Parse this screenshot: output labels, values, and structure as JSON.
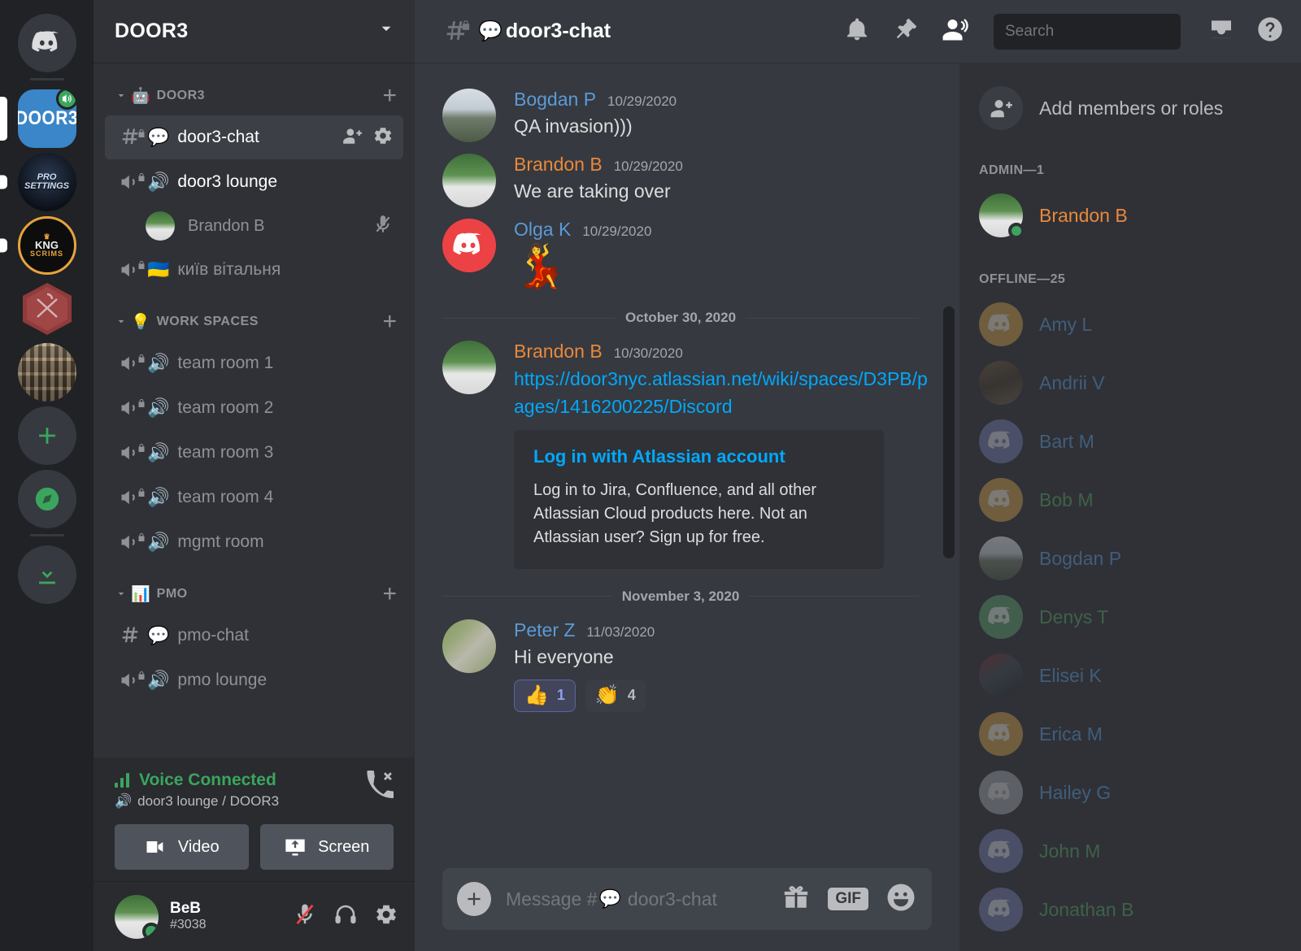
{
  "server_rail": {
    "home_label": "Discord Home",
    "servers": [
      {
        "name": "DOOR3",
        "type": "door3",
        "selected": true,
        "voice_active": true
      },
      {
        "name": "PRO SETTINGS",
        "type": "pro",
        "line1": "PRO",
        "line2": "SETTINGS",
        "unread": true
      },
      {
        "name": "KNG SCRIMS",
        "type": "kng",
        "line1": "KNG",
        "line2": "SCRIMS",
        "unread": true
      },
      {
        "name": "Hex Clan",
        "type": "hex",
        "unread": false
      },
      {
        "name": "Bookshelf Server",
        "type": "books",
        "unread": false
      }
    ],
    "add_server_label": "Add a Server",
    "explore_label": "Explore Public Servers",
    "download_label": "Download Apps"
  },
  "sidebar": {
    "guild_name": "DOOR3",
    "guild_dropdown_icon": "chevron-down-icon",
    "categories": [
      {
        "name": "DOOR3",
        "emoji": "🤖",
        "add_icon": "plus-icon",
        "channels": [
          {
            "name": "door3-chat",
            "emoji": "💬",
            "type": "text",
            "locked": true,
            "active": true,
            "actions": [
              "invite-icon",
              "gear-icon"
            ]
          },
          {
            "name": "door3 lounge",
            "emoji": "🔊",
            "type": "voice",
            "locked": true,
            "active": false,
            "voice_members": [
              {
                "name": "Brandon B",
                "muted": true
              }
            ]
          },
          {
            "name": "київ вітальня",
            "emoji": "🇺🇦",
            "type": "voice",
            "locked": true,
            "active": false
          }
        ]
      },
      {
        "name": "WORK SPACES",
        "emoji": "💡",
        "add_icon": "plus-icon",
        "channels": [
          {
            "name": "team room 1",
            "emoji": "🔊",
            "type": "voice",
            "locked": true
          },
          {
            "name": "team room 2",
            "emoji": "🔊",
            "type": "voice",
            "locked": true
          },
          {
            "name": "team room 3",
            "emoji": "🔊",
            "type": "voice",
            "locked": true
          },
          {
            "name": "team room 4",
            "emoji": "🔊",
            "type": "voice",
            "locked": true
          },
          {
            "name": "mgmt room",
            "emoji": "🔊",
            "type": "voice",
            "locked": true
          }
        ]
      },
      {
        "name": "PMO",
        "emoji": "📊",
        "add_icon": "plus-icon",
        "channels": [
          {
            "name": "pmo-chat",
            "emoji": "💬",
            "type": "text",
            "locked": false
          },
          {
            "name": "pmo lounge",
            "emoji": "🔊",
            "type": "voice",
            "locked": true
          }
        ]
      }
    ],
    "voice_panel": {
      "status": "Voice Connected",
      "channel_path": "door3 lounge / DOOR3",
      "channel_emoji": "🔊",
      "disconnect_icon": "phone-hangup-icon",
      "video_label": "Video",
      "screen_label": "Screen"
    },
    "user_panel": {
      "username": "BeB",
      "discriminator": "#3038",
      "status": "online",
      "mute_icon": "mic-muted-icon",
      "deafen_icon": "headphones-icon",
      "settings_icon": "gear-icon"
    }
  },
  "topbar": {
    "channel_name": "door3-chat",
    "channel_emoji": "💬",
    "hash_icon": "hash-lock-icon",
    "icons": [
      "bell-icon",
      "pin-icon",
      "members-icon",
      "inbox-icon",
      "help-icon"
    ],
    "search_placeholder": "Search",
    "search_value": ""
  },
  "chat": {
    "messages": [
      {
        "author": "Bogdan P",
        "color": "blue",
        "avatar": "av-bogdan",
        "timestamp": "10/29/2020",
        "text": "QA invasion)))",
        "kind": "text"
      },
      {
        "author": "Brandon B",
        "color": "orange",
        "avatar": "av-brandon",
        "timestamp": "10/29/2020",
        "text": "We are taking over",
        "kind": "text"
      },
      {
        "author": "Olga K",
        "color": "blue",
        "avatar": "av-olga",
        "timestamp": "10/29/2020",
        "text": "💃",
        "kind": "emoji"
      }
    ],
    "divider_1": "October 30, 2020",
    "message_link": {
      "author": "Brandon B",
      "color": "orange",
      "avatar": "av-brandon",
      "timestamp": "10/30/2020",
      "url": "https://door3nyc.atlassian.net/wiki/spaces/D3PB/pages/1416200225/Discord",
      "embed": {
        "title": "Log in with Atlassian account",
        "description": "Log in to Jira, Confluence, and all other Atlassian Cloud products here. Not an Atlassian user? Sign up for free."
      }
    },
    "divider_2": "November 3, 2020",
    "message_last": {
      "author": "Peter Z",
      "color": "blue",
      "avatar": "av-peter",
      "timestamp": "11/03/2020",
      "text": "Hi everyone",
      "reactions": [
        {
          "emoji": "👍",
          "count": "1",
          "mine": true
        },
        {
          "emoji": "👏",
          "count": "4",
          "mine": false
        }
      ]
    },
    "composer": {
      "placeholder_prefix": "Message #",
      "placeholder_emoji": "💬",
      "placeholder_channel": "door3-chat",
      "value": "",
      "attach_icon": "plus-circle-icon",
      "gift_icon": "gift-icon",
      "gif_label": "GIF",
      "emoji_icon": "emoji-icon"
    }
  },
  "members": {
    "add_label": "Add members or roles",
    "add_icon": "person-plus-icon",
    "groups": [
      {
        "title": "ADMIN—1",
        "people": [
          {
            "name": "Brandon B",
            "color": "#e8893c",
            "avatar": "av-brandon",
            "online": true
          }
        ]
      },
      {
        "title": "OFFLINE—25",
        "people": [
          {
            "name": "Amy L",
            "color": "#5b9ad8",
            "avatar": "av-gold",
            "online": false
          },
          {
            "name": "Andrii V",
            "color": "#5b9ad8",
            "avatar": "av-andrii",
            "online": false
          },
          {
            "name": "Bart M",
            "color": "#5b9ad8",
            "avatar": "av-blurple",
            "online": false
          },
          {
            "name": "Bob M",
            "color": "#57a463",
            "avatar": "av-gold",
            "online": false
          },
          {
            "name": "Bogdan P",
            "color": "#5b9ad8",
            "avatar": "av-bogdan",
            "online": false
          },
          {
            "name": "Denys T",
            "color": "#57a463",
            "avatar": "av-green",
            "online": false
          },
          {
            "name": "Elisei K",
            "color": "#5b9ad8",
            "avatar": "av-elisei",
            "online": false
          },
          {
            "name": "Erica M",
            "color": "#5b9ad8",
            "avatar": "av-gold",
            "online": false
          },
          {
            "name": "Hailey G",
            "color": "#5b9ad8",
            "avatar": "av-grey",
            "online": false
          },
          {
            "name": "John M",
            "color": "#57a463",
            "avatar": "av-blurple",
            "online": false
          },
          {
            "name": "Jonathan B",
            "color": "#57a463",
            "avatar": "av-blurple",
            "online": false
          }
        ]
      }
    ]
  },
  "colors": {
    "rail_bg": "#202225",
    "sidebar_bg": "#2f3136",
    "main_bg": "#36393f",
    "brand_blue": "#3a86c8",
    "online_green": "#3ba55d",
    "link_blue": "#00a8fc",
    "author_orange": "#e8893c",
    "author_blue": "#5b9ad8"
  }
}
